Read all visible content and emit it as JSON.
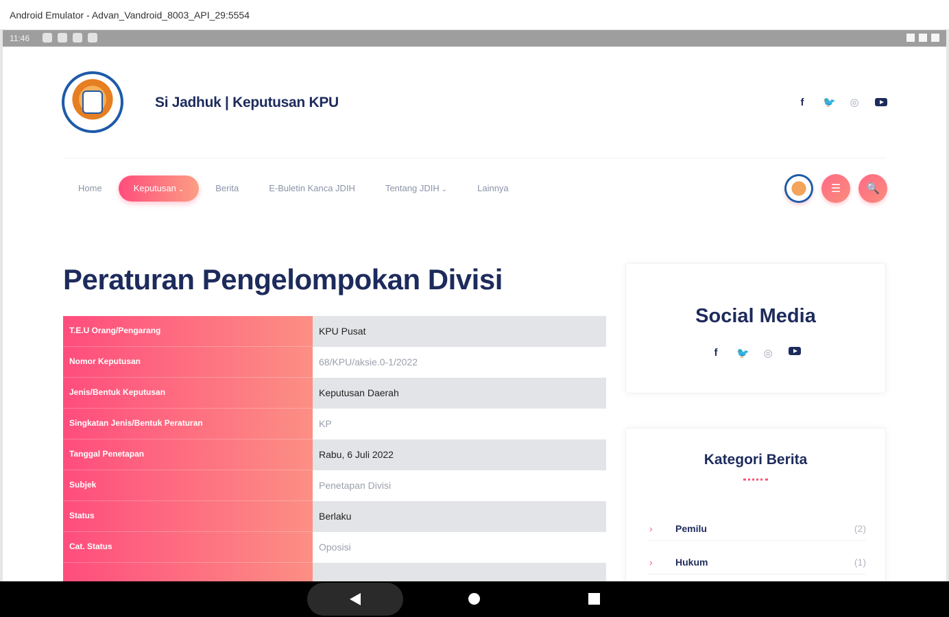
{
  "window": {
    "title": "Android Emulator - Advan_Vandroid_8003_API_29:5554"
  },
  "status_bar": {
    "time": "11:46"
  },
  "header": {
    "site_title": "Si Jadhuk | Keputusan KPU",
    "social_icons": [
      "facebook-icon",
      "twitter-icon",
      "instagram-icon",
      "youtube-icon"
    ],
    "social_glyphs": {
      "facebook": "f",
      "twitter": "🐦",
      "instagram": "◎"
    }
  },
  "nav": {
    "items": [
      {
        "label": "Home"
      },
      {
        "label": "Keputusan",
        "caret": "⌄"
      },
      {
        "label": "Berita"
      },
      {
        "label": "E-Buletin Kanca JDIH"
      },
      {
        "label": "Tentang JDIH",
        "caret": "⌄"
      },
      {
        "label": "Lainnya"
      }
    ],
    "menu_glyph": "☰",
    "search_glyph": "🔍"
  },
  "main": {
    "title": "Peraturan Pengelompokan Divisi",
    "rows": [
      {
        "label": "T.E.U Orang/Pengarang",
        "value": "KPU Pusat"
      },
      {
        "label": "Nomor Keputusan",
        "value": "68/KPU/aksie.0-1/2022"
      },
      {
        "label": "Jenis/Bentuk Keputusan",
        "value": "Keputusan Daerah"
      },
      {
        "label": "Singkatan Jenis/Bentuk Peraturan",
        "value": "KP"
      },
      {
        "label": "Tanggal Penetapan",
        "value": "Rabu, 6 Juli 2022"
      },
      {
        "label": "Subjek",
        "value": "Penetapan Divisi"
      },
      {
        "label": "Status",
        "value": "Berlaku"
      },
      {
        "label": "Cat. Status",
        "value": "Oposisi"
      }
    ]
  },
  "sidebar": {
    "social_title": "Social Media",
    "kategori_title": "Kategori Berita",
    "chevron_glyph": "›",
    "categories": [
      {
        "name": "Pemilu",
        "count": "(2)"
      },
      {
        "name": "Hukum",
        "count": "(1)"
      }
    ]
  },
  "colors": {
    "accent_start": "#ff4d7d",
    "accent_end": "#fb9e83",
    "heading": "#1d2b5c"
  }
}
